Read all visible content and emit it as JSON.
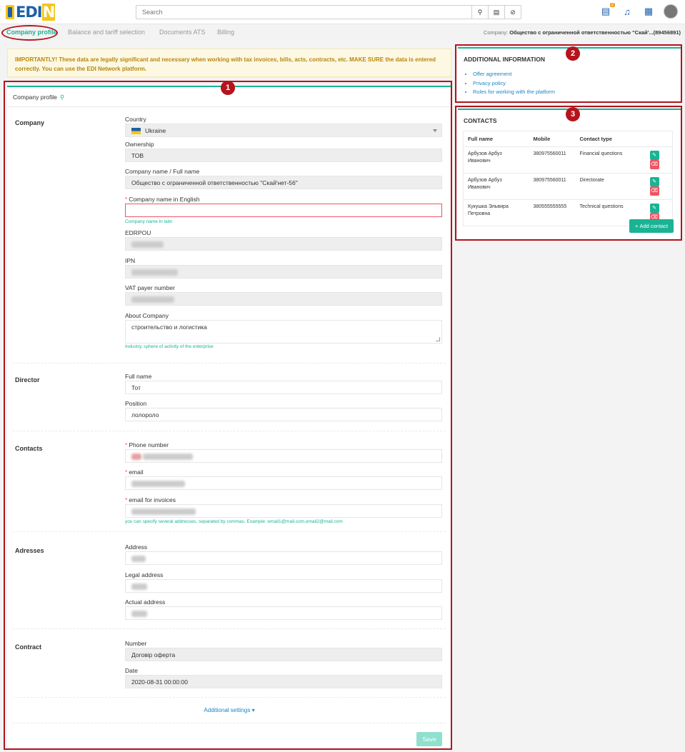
{
  "header": {
    "logo_text": "EDI",
    "logo_n": "N",
    "search_placeholder": "Search",
    "notification_badge": "2"
  },
  "tabs": [
    {
      "label": "Company profile",
      "active": true
    },
    {
      "label": "Balance and tariff selection",
      "active": false
    },
    {
      "label": "Documents ATS",
      "active": false
    },
    {
      "label": "Billing",
      "active": false
    }
  ],
  "company_line": {
    "prefix": "Company:",
    "name": "Общество с ограниченной ответственностью \"Скай'...(89456891)"
  },
  "warning": "IMPORTANTLY! These data are legally significant and necessary when working with tax invoices, bills, acts, contracts, etc. MAKE SURE the data is entered correctly. You can use the EDI Network platform.",
  "profile": {
    "title": "Company profile",
    "sections": {
      "company": "Company",
      "director": "Director",
      "contacts": "Contacts",
      "addresses": "Adresses",
      "contract": "Contract"
    },
    "fields": {
      "country_label": "Country",
      "country_value": "Ukraine",
      "ownership_label": "Ownership",
      "ownership_value": "ТОВ",
      "name_label": "Company name / Full name",
      "name_value": "Общество с ограниченной  ответственностью \"Скай'нет-56\"",
      "name_en_label": "Company name in English",
      "name_en_hint": "Company name in latin",
      "edrpou_label": "EDRPOU",
      "ipn_label": "IPN",
      "vat_label": "VAT payer number",
      "about_label": "About Company",
      "about_value": "строительство  и логистика",
      "about_hint": "Industry, sphere of activity of the enterprise",
      "dir_name_label": "Full name",
      "dir_name_value": "Тот",
      "dir_pos_label": "Position",
      "dir_pos_value": "лолороло",
      "phone_label": "Phone number",
      "email_label": "email",
      "email_inv_label": "email for invoices",
      "email_inv_hint": "you can specify several addresses, separated by commas. Example: email1@mail.com,email2@mail.com",
      "address_label": "Address",
      "legal_address_label": "Legal address",
      "actual_address_label": "Actual address",
      "number_label": "Number",
      "number_value": "Договір оферта",
      "date_label": "Date",
      "date_value": "2020-08-31 00:00:00"
    },
    "additional_settings": "Additional settings",
    "save": "Save"
  },
  "additional_info": {
    "title": "ADDITIONAL INFORMATION",
    "links": [
      "Offer agreement",
      "Privacy policy",
      "Rules for working with the platform"
    ]
  },
  "contacts": {
    "title": "CONTACTS",
    "columns": [
      "Full name",
      "Mobile",
      "Contact type"
    ],
    "rows": [
      {
        "name": "Арбузов Арбуз Иванович",
        "mobile": "380975560011",
        "type": "Financial questions"
      },
      {
        "name": "Арбузов Арбуз Иванович",
        "mobile": "380975560011",
        "type": "Directorate"
      },
      {
        "name": "Кукушка Эльвира Петровна",
        "mobile": "380555555555",
        "type": "Technical questions"
      }
    ],
    "add_button": "Add contact"
  },
  "annotations": [
    "1",
    "2",
    "3"
  ]
}
